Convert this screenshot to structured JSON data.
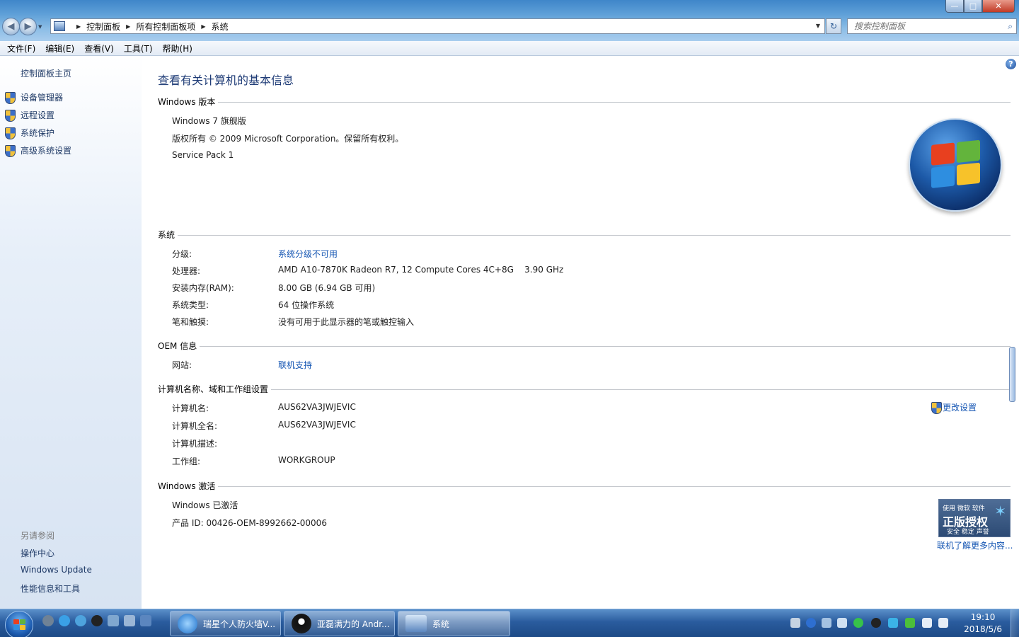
{
  "window": {
    "minimize": "—",
    "maximize": "□",
    "close": "✕"
  },
  "address": {
    "crumbs": [
      "控制面板",
      "所有控制面板项",
      "系统"
    ],
    "search_placeholder": "搜索控制面板"
  },
  "menu": [
    "文件(F)",
    "编辑(E)",
    "查看(V)",
    "工具(T)",
    "帮助(H)"
  ],
  "sidebar": {
    "home": "控制面板主页",
    "links": [
      "设备管理器",
      "远程设置",
      "系统保护",
      "高级系统设置"
    ],
    "see_also": "另请参阅",
    "see_also_links": [
      "操作中心",
      "Windows Update",
      "性能信息和工具"
    ]
  },
  "main": {
    "title": "查看有关计算机的基本信息",
    "edition": {
      "header": "Windows 版本",
      "name": "Windows 7 旗舰版",
      "copyright": "版权所有 © 2009 Microsoft Corporation。保留所有权利。",
      "service_pack": "Service Pack 1"
    },
    "system": {
      "header": "系统",
      "rows": [
        {
          "label": "分级:",
          "value": "系统分级不可用",
          "link": true
        },
        {
          "label": "处理器:",
          "value": "AMD A10-7870K Radeon R7, 12 Compute Cores 4C+8G    3.90 GHz"
        },
        {
          "label": "安装内存(RAM):",
          "value": "8.00 GB (6.94 GB 可用)"
        },
        {
          "label": "系统类型:",
          "value": "64 位操作系统"
        },
        {
          "label": "笔和触摸:",
          "value": "没有可用于此显示器的笔或触控输入"
        }
      ]
    },
    "oem": {
      "header": "OEM 信息",
      "rows": [
        {
          "label": "网站:",
          "value": "联机支持",
          "link": true
        }
      ]
    },
    "computer": {
      "header": "计算机名称、域和工作组设置",
      "change": "更改设置",
      "rows": [
        {
          "label": "计算机名:",
          "value": "AUS62VA3JWJEVIC"
        },
        {
          "label": "计算机全名:",
          "value": "AUS62VA3JWJEVIC"
        },
        {
          "label": "计算机描述:",
          "value": ""
        },
        {
          "label": "工作组:",
          "value": "WORKGROUP"
        }
      ]
    },
    "activation": {
      "header": "Windows 激活",
      "status": "Windows 已激活",
      "product_id": "产品 ID: 00426-OEM-8992662-00006",
      "badge_line1": "使用 微软 软件",
      "badge_line2": "正版授权",
      "badge_line3": "安全 稳定 声誉",
      "learn_more": "联机了解更多内容..."
    }
  },
  "taskbar": {
    "tasks": [
      "瑞星个人防火墙V...",
      "亚磊满力的 Andr...",
      "系统"
    ],
    "time": "19:10",
    "date": "2018/5/6"
  },
  "colors": {
    "link": "#1556b3",
    "title": "#1e3b76",
    "taskbar": "#2a5c9e"
  }
}
